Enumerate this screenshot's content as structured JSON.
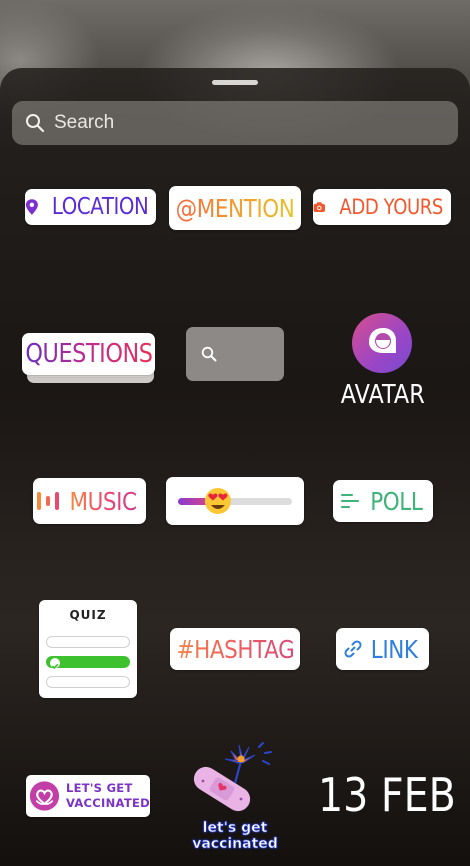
{
  "search": {
    "placeholder": "Search"
  },
  "stickers": {
    "location": "LOCATION",
    "mention": "@MENTION",
    "add_yours": "ADD YOURS",
    "questions": "QUESTIONS",
    "avatar": "AVATAR",
    "music": "MUSIC",
    "poll": "POLL",
    "quiz": "QUIZ",
    "hashtag": "#HASHTAG",
    "link": "LINK",
    "vaccine_line1": "LET'S GET",
    "vaccine_line2": "VACCINATED",
    "vaccine_caption_line1": "let's get",
    "vaccine_caption_line2": "vaccinated",
    "date": "13 FEB"
  },
  "slider": {
    "emoji": "heart-eyes-emoji",
    "level": 0.35
  },
  "icons": [
    "search-icon",
    "location-pin-icon",
    "camera-icon",
    "music-bars-icon",
    "poll-lines-icon",
    "link-icon",
    "check-icon",
    "heart-hands-icon",
    "bandage-flower-icon",
    "avatar-icon"
  ],
  "colors": {
    "location": "#5b2bd6",
    "add_yours": "#f0582e",
    "poll": "#3eb37a",
    "link": "#2f7fe0",
    "quiz_correct": "#3ec12f"
  }
}
